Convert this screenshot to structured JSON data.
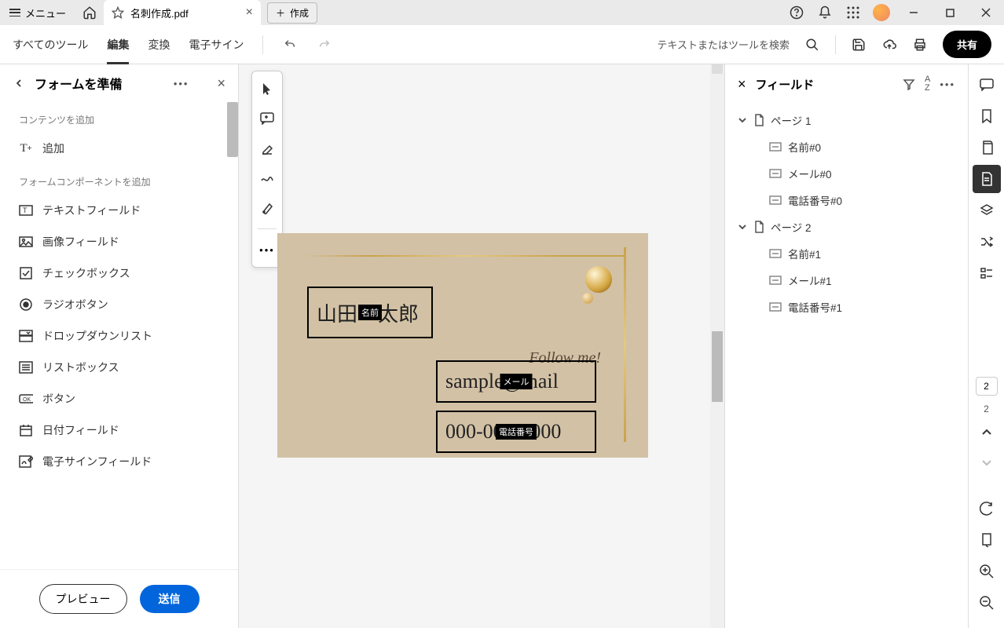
{
  "titlebar": {
    "menu": "メニュー",
    "tabTitle": "名刺作成.pdf",
    "create": "作成"
  },
  "toolbar": {
    "allTools": "すべてのツール",
    "edit": "編集",
    "convert": "変換",
    "esign": "電子サイン",
    "searchPlaceholder": "テキストまたはツールを検索",
    "share": "共有"
  },
  "leftPanel": {
    "title": "フォームを準備",
    "section1": "コンテンツを追加",
    "addText": "追加",
    "section2": "フォームコンポーネントを追加",
    "items": {
      "textField": "テキストフィールド",
      "imageField": "画像フィールド",
      "checkbox": "チェックボックス",
      "radio": "ラジオボタン",
      "dropdown": "ドロップダウンリスト",
      "listbox": "リストボックス",
      "button": "ボタン",
      "date": "日付フィールド",
      "esignField": "電子サインフィールド"
    },
    "preview": "プレビュー",
    "send": "送信"
  },
  "card": {
    "follow": "Follow me!",
    "name": {
      "value": "山田　太郎",
      "label": "名前"
    },
    "mail": {
      "value": "sample@mail",
      "label": "メール"
    },
    "phone": {
      "value": "000-0000-000",
      "label": "電話番号"
    }
  },
  "rightPanel": {
    "title": "フィールド",
    "page1": "ページ 1",
    "page2": "ページ 2",
    "f": {
      "name0": "名前#0",
      "mail0": "メール#0",
      "phone0": "電話番号#0",
      "name1": "名前#1",
      "mail1": "メール#1",
      "phone1": "電話番号#1"
    }
  },
  "pager": {
    "current": "2",
    "total": "2"
  }
}
